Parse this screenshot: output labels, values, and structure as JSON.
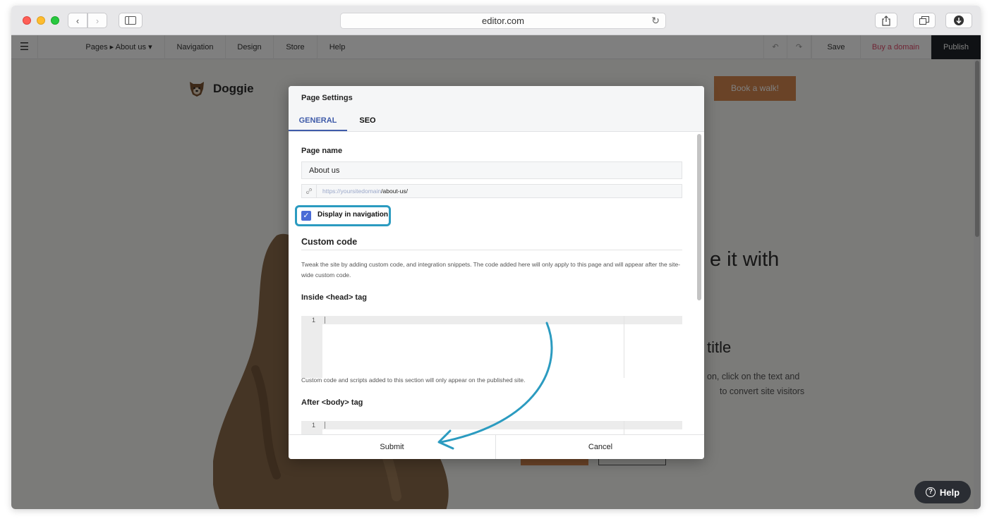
{
  "browser": {
    "url": "editor.com",
    "back_glyph": "‹",
    "fwd_glyph": "›",
    "reload_glyph": "↻"
  },
  "toolbar": {
    "menu_icon": "☰",
    "pages_label": "Pages ▸ About us ▾",
    "navigation_label": "Navigation",
    "design_label": "Design",
    "store_label": "Store",
    "help_label": "Help",
    "undo_icon": "↶",
    "redo_icon": "↷",
    "save_label": "Save",
    "buy_domain_label": "Buy a domain",
    "publish_label": "Publish"
  },
  "site": {
    "logo_text": "Doggie",
    "book_button": "Book a walk!",
    "hero_fragment": "e it with",
    "subtitle_fragment": "title",
    "paragraph_fragment_1": "on, click on the text and",
    "paragraph_fragment_2": "to convert site visitors"
  },
  "modal": {
    "title": "Page Settings",
    "tabs": [
      "GENERAL",
      "SEO"
    ],
    "page_name_label": "Page name",
    "page_name_value": "About us",
    "url_domain": "https://yoursitedomain",
    "url_slug": "/about-us/",
    "display_nav_label": "Display in navigation",
    "display_nav_checked": true,
    "custom_code_title": "Custom code",
    "custom_code_desc": "Tweak the site by adding custom code, and integration snippets. The code added here will only apply to this page and will appear after the site-wide custom code.",
    "head_label": "Inside <head> tag",
    "head_line_number": "1",
    "head_hint": "Custom code and scripts added to this section will only appear on the published site.",
    "body_label": "After <body> tag",
    "body_line_number": "1",
    "submit_label": "Submit",
    "cancel_label": "Cancel"
  },
  "help_button": {
    "label": "Help",
    "icon_glyph": "?"
  },
  "colors": {
    "accent_blue": "#3f5ba9",
    "highlight_teal": "#2b9bc0",
    "book_orange": "#d4874e",
    "publish_dark": "#1f2329",
    "domain_pink": "#e04a6a"
  }
}
